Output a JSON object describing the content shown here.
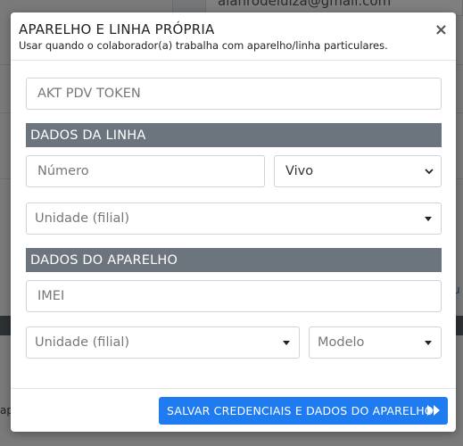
{
  "background": {
    "email_text": "alanrodeluiza@gmail.com",
    "side_text": "ap",
    "right_link": "u"
  },
  "modal": {
    "title": "APARELHO E LINHA PRÓPRIA",
    "subtitle": "Usar quando o colaborador(a) trabalha com aparelho/linha particulares.",
    "close_label": "×",
    "token_field": {
      "value": "AKT PDV TOKEN"
    },
    "line_section": {
      "heading": "DADOS DA LINHA",
      "number_placeholder": "Número",
      "carrier_selected": "Vivo",
      "unit_placeholder": "Unidade (filial)"
    },
    "device_section": {
      "heading": "DADOS DO APARELHO",
      "imei_placeholder": "IMEI",
      "unit_placeholder": "Unidade (filial)",
      "model_placeholder": "Modelo"
    },
    "save_button_label": "SALVAR CREDENCIAIS E DADOS DO APARELHO"
  },
  "colors": {
    "primary": "#1f7bf0",
    "section_bar": "#6c757d"
  },
  "icons": {
    "close": "close-icon",
    "select_arrow": "chevron-down-icon",
    "dropdown_caret": "caret-down-icon",
    "save": "fast-forward-icon"
  }
}
